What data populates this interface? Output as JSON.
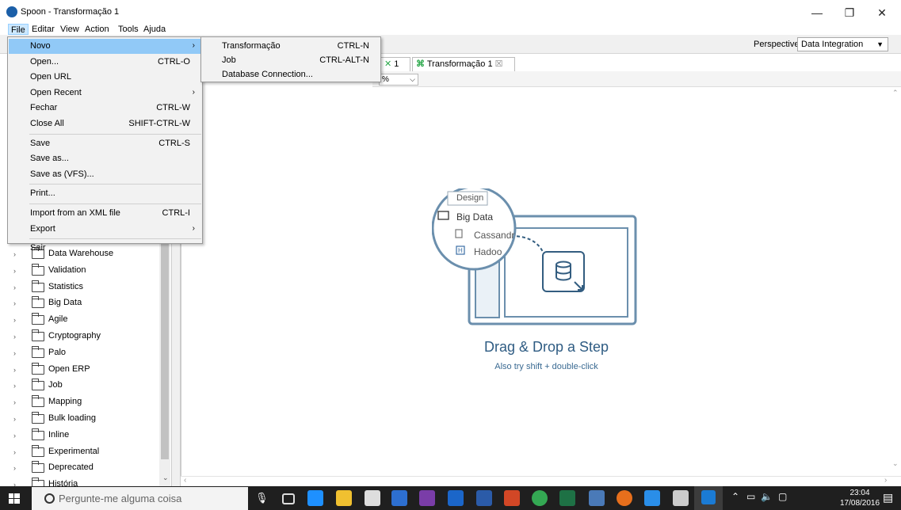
{
  "window": {
    "title": "Spoon - Transformação 1",
    "minimize": "—",
    "restore": "❐",
    "close": "✕"
  },
  "menubar": [
    "File",
    "Editar",
    "View",
    "Action",
    "Tools",
    "Ajuda"
  ],
  "perspective": {
    "label": "Perspective:",
    "value": "Data Integration"
  },
  "tabs": [
    {
      "label": "1"
    },
    {
      "label": "Transformação 1",
      "close": "☒"
    }
  ],
  "zoom": {
    "value": "%"
  },
  "file_menu": {
    "items": [
      {
        "label": "Novo",
        "shortcut": "",
        "submenu": true
      },
      {
        "label": "Open...",
        "shortcut": "CTRL-O"
      },
      {
        "label": "Open URL",
        "shortcut": ""
      },
      {
        "label": "Open Recent",
        "shortcut": "",
        "submenu": true
      },
      {
        "label": "Fechar",
        "shortcut": "CTRL-W"
      },
      {
        "label": "Close All",
        "shortcut": "SHIFT-CTRL-W"
      },
      {
        "label": "Save",
        "shortcut": "CTRL-S"
      },
      {
        "label": "Save as...",
        "shortcut": ""
      },
      {
        "label": "Save as (VFS)...",
        "shortcut": ""
      },
      {
        "label": "Print...",
        "shortcut": ""
      },
      {
        "label": "Import from an XML file",
        "shortcut": "CTRL-I"
      },
      {
        "label": "Export",
        "shortcut": "",
        "submenu": true
      },
      {
        "label": "Sair",
        "shortcut": ""
      }
    ]
  },
  "new_submenu": [
    {
      "label": "Transformação",
      "shortcut": "CTRL-N"
    },
    {
      "label": "Job",
      "shortcut": "CTRL-ALT-N"
    },
    {
      "label": "Database Connection...",
      "shortcut": ""
    }
  ],
  "tree": [
    "Data Warehouse",
    "Validation",
    "Statistics",
    "Big Data",
    "Agile",
    "Cryptography",
    "Palo",
    "Open ERP",
    "Job",
    "Mapping",
    "Bulk loading",
    "Inline",
    "Experimental",
    "Deprecated",
    "História"
  ],
  "canvas": {
    "illus_tab": "Design",
    "illus_folder": "Big Data",
    "illus_item1": "Cassandr",
    "illus_item2": "Hadoo",
    "illus_h": "H",
    "title": "Drag & Drop a Step",
    "hint": "Also try shift + double-click"
  },
  "taskbar": {
    "search_placeholder": "Pergunte-me alguma coisa",
    "time": "23:04",
    "date": "17/08/2016"
  }
}
